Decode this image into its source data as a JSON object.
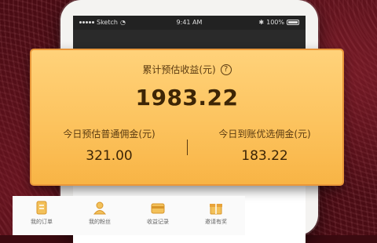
{
  "status_bar": {
    "carrier": "Sketch",
    "time": "9:41 AM",
    "battery": "100%"
  },
  "earnings_card": {
    "total_label": "累计预估收益(元)",
    "total_value": "1983.22",
    "left_label": "今日预估普通佣金(元)",
    "left_value": "321.00",
    "right_label": "今日到账优选佣金(元)",
    "right_value": "183.22"
  },
  "nav": {
    "items": [
      {
        "label": "我的订单",
        "icon": "order-icon"
      },
      {
        "label": "我的粉丝",
        "icon": "user-icon"
      },
      {
        "label": "收益记录",
        "icon": "wallet-icon"
      },
      {
        "label": "邀请有奖",
        "icon": "gift-icon"
      }
    ]
  },
  "colors": {
    "card_top": "#ffd27a",
    "card_bottom": "#f8b445",
    "card_border": "#e9973a",
    "text_dark": "#3d2506",
    "icon_gold": "#e8a33a",
    "background": "#4a0c14"
  }
}
